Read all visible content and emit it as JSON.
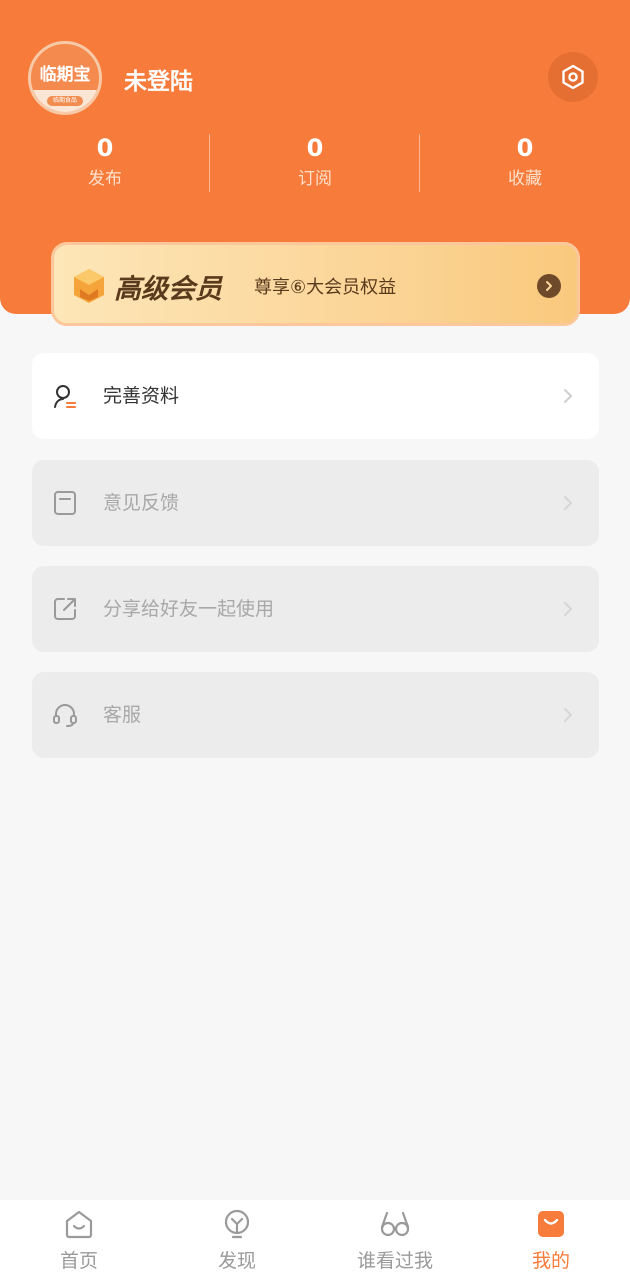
{
  "profile": {
    "avatar_text": "临期宝",
    "avatar_sub": "临期食品",
    "username": "未登陆"
  },
  "stats": [
    {
      "value": "0",
      "label": "发布"
    },
    {
      "value": "0",
      "label": "订阅"
    },
    {
      "value": "0",
      "label": "收藏"
    }
  ],
  "vip": {
    "title": "高级会员",
    "subtitle": "尊享⑥大会员权益"
  },
  "menu": [
    {
      "label": "完善资料",
      "icon": "user-edit-icon"
    },
    {
      "label": "意见反馈",
      "icon": "feedback-doc-icon"
    },
    {
      "label": "分享给好友一起使用",
      "icon": "share-icon"
    },
    {
      "label": "客服",
      "icon": "headset-icon"
    }
  ],
  "tabs": [
    {
      "label": "首页",
      "icon": "home-icon"
    },
    {
      "label": "发现",
      "icon": "discover-icon"
    },
    {
      "label": "谁看过我",
      "icon": "glasses-icon"
    },
    {
      "label": "我的",
      "icon": "mine-bag-icon"
    }
  ],
  "colors": {
    "accent": "#f77b3a",
    "background": "#f7f7f7",
    "vip_text": "#5a3a1c"
  }
}
